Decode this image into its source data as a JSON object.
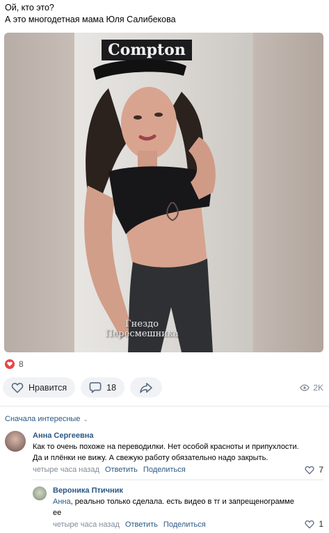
{
  "post": {
    "line1": "Ой, кто это?",
    "line2": "А это многодетная мама Юля Салибекова"
  },
  "media": {
    "cap_text": "Compton",
    "watermark_line1": "Гнездо",
    "watermark_line2": "Пересмешника",
    "icon": "photo"
  },
  "reactions": {
    "count": "8",
    "icon": "heart-filled-icon",
    "color": "#e64646"
  },
  "actions": {
    "like_label": "Нравится",
    "comments_count": "18",
    "share_icon": "share-arrow-icon",
    "views": "2K"
  },
  "comments_header": {
    "sort_label": "Сначала интересные"
  },
  "comments": [
    {
      "author": "Анна Сергеевна",
      "text_line1": "Как то очень похоже на переводилки. Нет особой красноты и припухлости.",
      "text_line2": "Да и плёнки не вижу. А свежую работу обязательно надо закрыть.",
      "time": "четыре часа назад",
      "reply_label": "Ответить",
      "share_label": "Поделиться",
      "likes": "7"
    },
    {
      "author": "Вероника Птичник",
      "mention": "Анна",
      "text_line1": ", реально только сделала. есть видео в тг и запрещенограмме",
      "text_line2": "ее",
      "time": "четыре часа назад",
      "reply_label": "Ответить",
      "share_label": "Поделиться",
      "likes": "1"
    }
  ],
  "colors": {
    "link": "#2a5885",
    "muted": "#818c99",
    "pill_bg": "#f0f2f5"
  }
}
